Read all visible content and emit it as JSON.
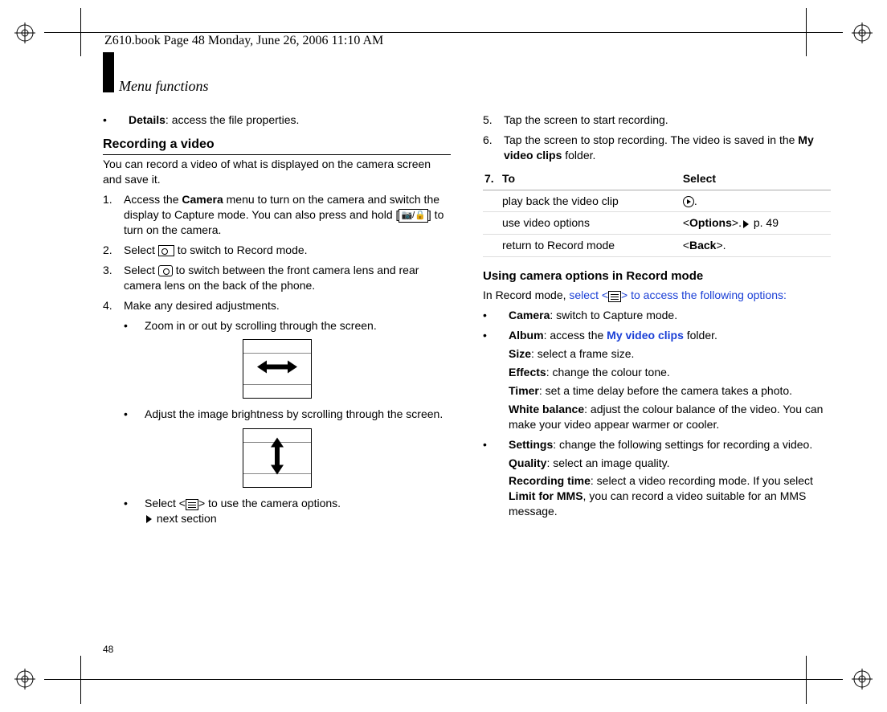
{
  "draft_header": "Z610.book  Page 48  Monday, June 26, 2006  11:10 AM",
  "section_title": "Menu functions",
  "page_number": "48",
  "left": {
    "details_label": "Details",
    "details_desc": ": access the file properties.",
    "heading_record": "Recording a video",
    "record_intro": "You can record a video of what is displayed on the camera screen and save it.",
    "step1_num": "1.",
    "step1_a": "Access the ",
    "step1_b": "Camera",
    "step1_c": " menu to turn on the camera and switch the display to Capture mode. You can also press and hold [",
    "step1_d": "] to turn on the camera.",
    "step2_num": "2.",
    "step2_a": "Select ",
    "step2_b": " to switch to Record mode.",
    "step3_num": "3.",
    "step3_a": "Select ",
    "step3_b": " to switch between the front camera lens and rear camera lens on the back of the phone.",
    "step4_num": "4.",
    "step4_text": "Make any desired adjustments.",
    "zoom_bullet": "Zoom in or out by scrolling through the screen.",
    "bright_bullet": "Adjust the image brightness by scrolling through the screen.",
    "select_opts_a": "Select <",
    "select_opts_b": "> to use the camera options.",
    "next_section": " next section"
  },
  "right": {
    "step5_num": "5.",
    "step5_text": "Tap the screen to start recording.",
    "step6_num": "6.",
    "step6_a": "Tap the screen to stop recording. The video is saved in the ",
    "step6_b": "My video clips",
    "step6_c": " folder.",
    "table_num": "7.",
    "th_to": "To",
    "th_select": "Select",
    "row1_to": "play back the video clip",
    "row1_sel_suffix": ".",
    "row2_to": "use video options",
    "row2_sel_a": "<",
    "row2_sel_b": "Options",
    "row2_sel_c": ">.",
    "row2_sel_d": " p. 49",
    "row3_to": "return to Record mode",
    "row3_sel_a": "<",
    "row3_sel_b": "Back",
    "row3_sel_c": ">.",
    "heading_using": "Using camera options in Record mode",
    "using_intro_a": "In Record mode, ",
    "using_intro_b": "select <",
    "using_intro_c": "> to access the following options:",
    "opt_camera_label": "Camera",
    "opt_camera_desc": ": switch to Capture mode.",
    "opt_album_label": "Album",
    "opt_album_desc_a": ": access the ",
    "opt_album_desc_b": "My video clips",
    "opt_album_desc_c": " folder.",
    "opt_size_label": "Size",
    "opt_size_desc": ": select a frame size.",
    "opt_effects_label": "Effects",
    "opt_effects_desc": ": change the colour tone.",
    "opt_timer_label": "Timer",
    "opt_timer_desc": ": set a time delay before the camera takes a photo.",
    "opt_wb_label": "White balance",
    "opt_wb_desc": ": adjust the colour balance of the video. You can make your video appear warmer or cooler.",
    "opt_settings_label": "Settings",
    "opt_settings_desc": ": change the following settings for recording a video.",
    "opt_quality_label": "Quality",
    "opt_quality_desc": ": select an image quality.",
    "opt_rectime_label": "Recording time",
    "opt_rectime_desc_a": ": select a video recording mode. If you select ",
    "opt_rectime_desc_b": "Limit for MMS",
    "opt_rectime_desc_c": ", you can record a video suitable for an MMS message."
  }
}
